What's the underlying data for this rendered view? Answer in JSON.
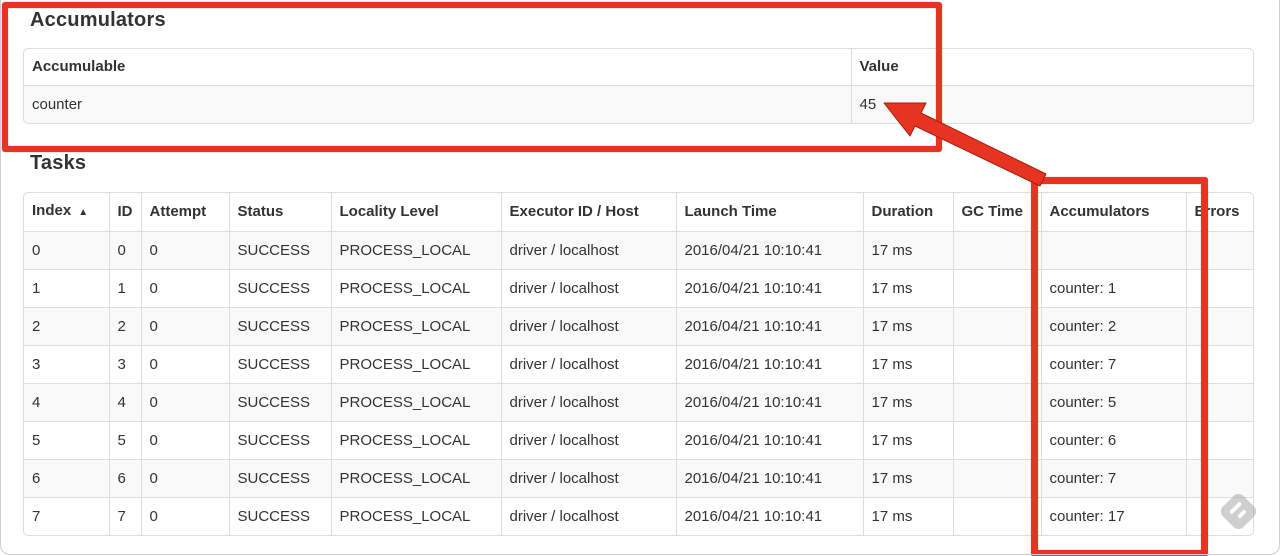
{
  "accumulators": {
    "heading": "Accumulators",
    "columns": [
      "Accumulable",
      "Value"
    ],
    "rows": [
      {
        "accumulable": "counter",
        "value": "45"
      }
    ]
  },
  "tasks": {
    "heading": "Tasks",
    "columns": [
      {
        "key": "index",
        "label": "Index",
        "sort_indicator": "▲"
      },
      {
        "key": "id",
        "label": "ID"
      },
      {
        "key": "attempt",
        "label": "Attempt"
      },
      {
        "key": "status",
        "label": "Status"
      },
      {
        "key": "locality_level",
        "label": "Locality Level"
      },
      {
        "key": "executor_id_host",
        "label": "Executor ID / Host"
      },
      {
        "key": "launch_time",
        "label": "Launch Time"
      },
      {
        "key": "duration",
        "label": "Duration"
      },
      {
        "key": "gc_time",
        "label": "GC Time"
      },
      {
        "key": "accumulators",
        "label": "Accumulators"
      },
      {
        "key": "errors",
        "label": "Errors"
      }
    ],
    "rows": [
      {
        "index": "0",
        "id": "0",
        "attempt": "0",
        "status": "SUCCESS",
        "locality_level": "PROCESS_LOCAL",
        "executor_id_host": "driver / localhost",
        "launch_time": "2016/04/21 10:10:41",
        "duration": "17 ms",
        "gc_time": "",
        "accumulators": "",
        "errors": ""
      },
      {
        "index": "1",
        "id": "1",
        "attempt": "0",
        "status": "SUCCESS",
        "locality_level": "PROCESS_LOCAL",
        "executor_id_host": "driver / localhost",
        "launch_time": "2016/04/21 10:10:41",
        "duration": "17 ms",
        "gc_time": "",
        "accumulators": "counter: 1",
        "errors": ""
      },
      {
        "index": "2",
        "id": "2",
        "attempt": "0",
        "status": "SUCCESS",
        "locality_level": "PROCESS_LOCAL",
        "executor_id_host": "driver / localhost",
        "launch_time": "2016/04/21 10:10:41",
        "duration": "17 ms",
        "gc_time": "",
        "accumulators": "counter: 2",
        "errors": ""
      },
      {
        "index": "3",
        "id": "3",
        "attempt": "0",
        "status": "SUCCESS",
        "locality_level": "PROCESS_LOCAL",
        "executor_id_host": "driver / localhost",
        "launch_time": "2016/04/21 10:10:41",
        "duration": "17 ms",
        "gc_time": "",
        "accumulators": "counter: 7",
        "errors": ""
      },
      {
        "index": "4",
        "id": "4",
        "attempt": "0",
        "status": "SUCCESS",
        "locality_level": "PROCESS_LOCAL",
        "executor_id_host": "driver / localhost",
        "launch_time": "2016/04/21 10:10:41",
        "duration": "17 ms",
        "gc_time": "",
        "accumulators": "counter: 5",
        "errors": ""
      },
      {
        "index": "5",
        "id": "5",
        "attempt": "0",
        "status": "SUCCESS",
        "locality_level": "PROCESS_LOCAL",
        "executor_id_host": "driver / localhost",
        "launch_time": "2016/04/21 10:10:41",
        "duration": "17 ms",
        "gc_time": "",
        "accumulators": "counter: 6",
        "errors": ""
      },
      {
        "index": "6",
        "id": "6",
        "attempt": "0",
        "status": "SUCCESS",
        "locality_level": "PROCESS_LOCAL",
        "executor_id_host": "driver / localhost",
        "launch_time": "2016/04/21 10:10:41",
        "duration": "17 ms",
        "gc_time": "",
        "accumulators": "counter: 7",
        "errors": ""
      },
      {
        "index": "7",
        "id": "7",
        "attempt": "0",
        "status": "SUCCESS",
        "locality_level": "PROCESS_LOCAL",
        "executor_id_host": "driver / localhost",
        "launch_time": "2016/04/21 10:10:41",
        "duration": "17 ms",
        "gc_time": "",
        "accumulators": "counter: 17",
        "errors": ""
      }
    ]
  },
  "annotation": {
    "color": "#e73422"
  }
}
